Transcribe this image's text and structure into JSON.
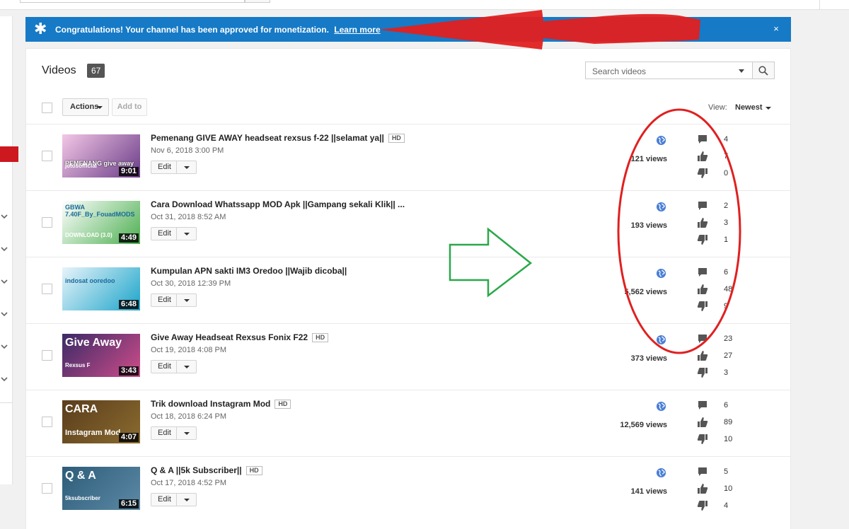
{
  "banner": {
    "message": "Congratulations! Your channel has been approved for monetization.",
    "link": "Learn more",
    "close": "×"
  },
  "videos_header": {
    "title": "Videos",
    "count": "67",
    "search_placeholder": "Search videos",
    "actions_label": "Actions",
    "add_to_label": "Add to",
    "view_label": "View:",
    "view_value": "Newest"
  },
  "videos": [
    {
      "title": "Pemenang GIVE AWAY headseat rexsus f-22 ||selamat ya||",
      "hd": "HD",
      "date": "Nov 6, 2018 3:00 PM",
      "duration": "9:01",
      "views": "121 views",
      "comments": "4",
      "likes": "7",
      "dislikes": "0",
      "thumb_text": "PEMENANG give away",
      "thumb_sub": "jotosofficial",
      "thumb_colors": [
        "#f3c7e6",
        "#6a3c88"
      ]
    },
    {
      "title": "Cara Download Whatssapp MOD Apk ||Gampang sekali Klik||  ...",
      "hd": "",
      "date": "Oct 31, 2018 8:52 AM",
      "duration": "4:49",
      "views": "193 views",
      "comments": "2",
      "likes": "3",
      "dislikes": "1",
      "thumb_text": "GBWA 7.40F_By_FouadMODS",
      "thumb_sub": "DOWNLOAD (3.0)",
      "thumb_colors": [
        "#ffffff",
        "#4caf50"
      ]
    },
    {
      "title": "Kumpulan APN sakti IM3 Oredoo ||Wajib dicoba||",
      "hd": "",
      "date": "Oct 30, 2018 12:39 PM",
      "duration": "6:48",
      "views": "5,562 views",
      "comments": "6",
      "likes": "48",
      "dislikes": "9",
      "thumb_text": "indosat ooredoo",
      "thumb_sub": "",
      "thumb_colors": [
        "#e8f4fb",
        "#1ba4c9"
      ]
    },
    {
      "title": "Give Away Headseat Rexsus Fonix F22",
      "hd": "HD",
      "date": "Oct 19, 2018 4:08 PM",
      "duration": "3:43",
      "views": "373 views",
      "comments": "23",
      "likes": "27",
      "dislikes": "3",
      "thumb_text": "Give Away",
      "thumb_sub": "Rexsus F",
      "thumb_colors": [
        "#3a2a66",
        "#cf4d8a"
      ]
    },
    {
      "title": "Trik download Instagram Mod",
      "hd": "HD",
      "date": "Oct 18, 2018 6:24 PM",
      "duration": "4:07",
      "views": "12,569 views",
      "comments": "6",
      "likes": "89",
      "dislikes": "10",
      "thumb_text": "CARA",
      "thumb_sub": "Instagram Mod",
      "thumb_colors": [
        "#5a3d1c",
        "#8a6b2f"
      ]
    },
    {
      "title": "Q & A ||5k Subscriber||",
      "hd": "HD",
      "date": "Oct 17, 2018 4:52 PM",
      "duration": "6:15",
      "views": "141 views",
      "comments": "5",
      "likes": "10",
      "dislikes": "4",
      "thumb_text": "Q & A",
      "thumb_sub": "5ksubscriber",
      "thumb_colors": [
        "#2d5c7a",
        "#5c8aa5"
      ]
    }
  ],
  "colors": {
    "banner_bg": "#167ac6",
    "annotation_red": "#e02020",
    "annotation_green": "#2aa84a",
    "globe_blue": "#4a7fd6"
  },
  "icons": {
    "banner": "asterisk-icon",
    "close": "close-icon",
    "search": "search-icon",
    "privacy": "globe-icon",
    "comments": "comment-icon",
    "likes": "thumbs-up-icon",
    "dislikes": "thumbs-down-icon"
  }
}
